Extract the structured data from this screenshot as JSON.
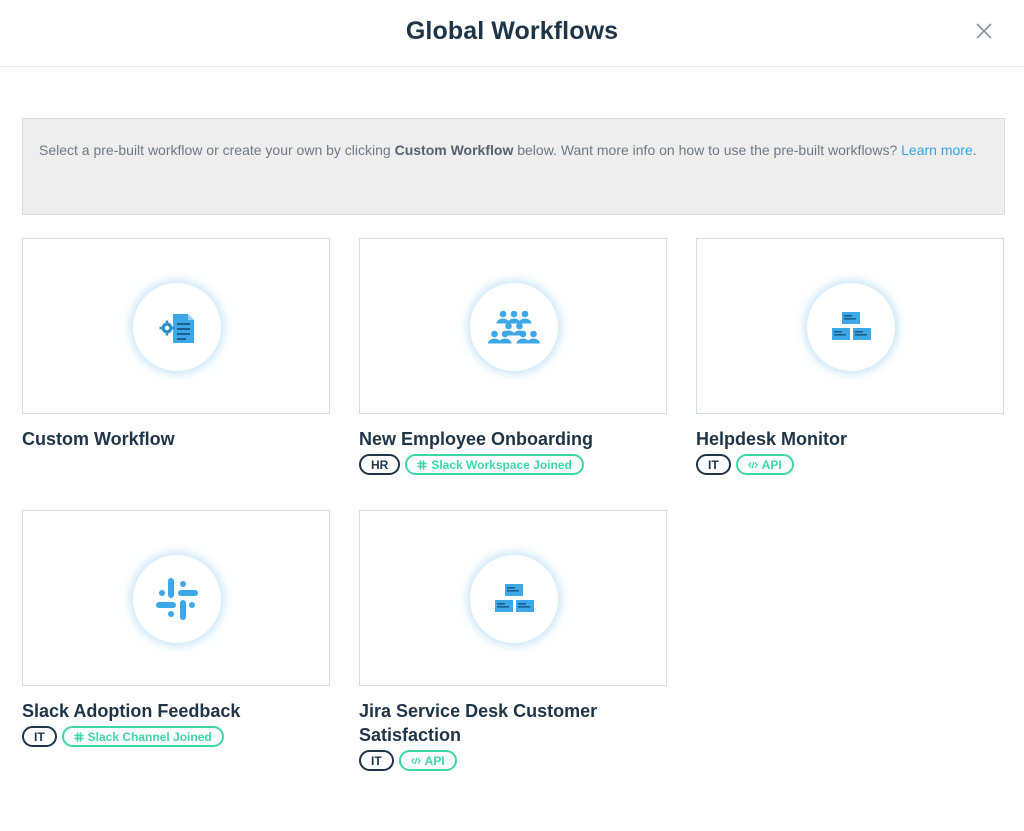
{
  "header": {
    "title": "Global Workflows"
  },
  "banner": {
    "text_before": "Select a pre-built workflow or create your own by clicking ",
    "bold": "Custom Workflow",
    "text_after": " below. Want more info on how to use the pre-built workflows? ",
    "link": "Learn more",
    "end": "."
  },
  "cards": [
    {
      "title": "Custom Workflow",
      "icon": "document-gear-icon",
      "tags": []
    },
    {
      "title": "New Employee Onboarding",
      "icon": "people-hierarchy-icon",
      "tags": [
        {
          "label": "HR"
        },
        {
          "label": "Slack Workspace Joined",
          "icon": "slack-icon"
        }
      ]
    },
    {
      "title": "Helpdesk Monitor",
      "icon": "ticket-stack-icon",
      "tags": [
        {
          "label": "IT"
        },
        {
          "label": "API",
          "icon": "code-icon"
        }
      ]
    },
    {
      "title": "Slack Adoption Feedback",
      "icon": "slack-icon",
      "tags": [
        {
          "label": "IT"
        },
        {
          "label": "Slack Channel Joined",
          "icon": "slack-icon"
        }
      ]
    },
    {
      "title": "Jira Service Desk Customer Satisfaction",
      "icon": "ticket-stack-icon",
      "tags": [
        {
          "label": "IT"
        },
        {
          "label": "API",
          "icon": "code-icon"
        }
      ]
    }
  ],
  "colors": {
    "accent": "#2aa6e6",
    "tag_green": "#3fd6a7",
    "text_dark": "#1f3547",
    "icon_blue": "#3ea7e8"
  }
}
